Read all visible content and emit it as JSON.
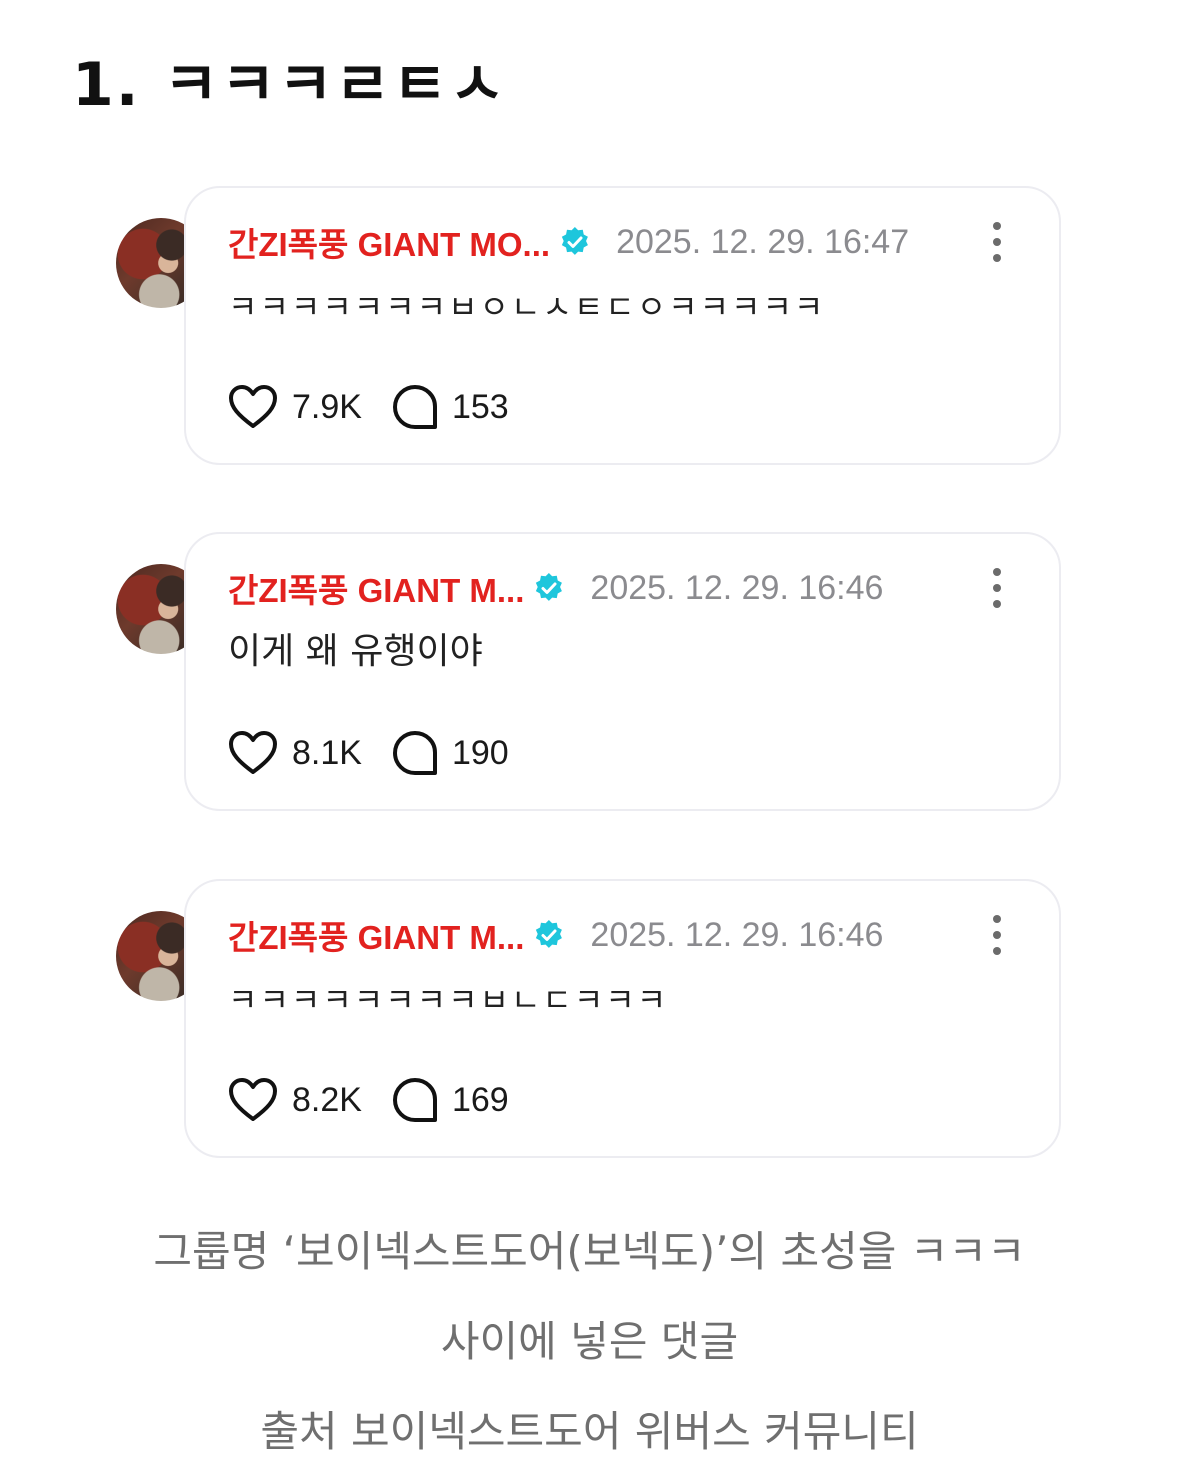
{
  "heading": "1. ㅋㅋㅋㄹㅌㅅ",
  "comments": [
    {
      "author": "간ZI폭풍 GIANT MO...",
      "time": "2025. 12. 29. 16:47",
      "text": "ㅋㅋㅋㅋㅋㅋㅋㅂㅇㄴㅅㅌㄷㅇㅋㅋㅋㅋㅋ",
      "likes": "7.9K",
      "replies": "153"
    },
    {
      "author": "간ZI폭풍 GIANT M...",
      "time": "2025. 12. 29. 16:46",
      "text": "이게 왜 유행이야",
      "likes": "8.1K",
      "replies": "190"
    },
    {
      "author": "간ZI폭풍 GIANT M...",
      "time": "2025. 12. 29. 16:46",
      "text": "ㅋㅋㅋㅋㅋㅋㅋㅋㅂㄴㄷㅋㅋㅋ",
      "likes": "8.2K",
      "replies": "169"
    }
  ],
  "caption": {
    "line1": "그룹명 ‘보이넥스트도어(보넥도)’의 초성을 ㅋㅋㅋ",
    "line2": "사이에 넣은 댓글",
    "line3": "출처 보이넥스트도어 위버스 커뮤니티"
  },
  "colors": {
    "author": "#e2221f",
    "verified_badge": "#1ec6dc",
    "timestamp": "#8b8b8f",
    "card_border": "#ececf1"
  },
  "icons": [
    "verified-badge-icon",
    "more-options-icon",
    "heart-icon",
    "comment-bubble-icon"
  ]
}
